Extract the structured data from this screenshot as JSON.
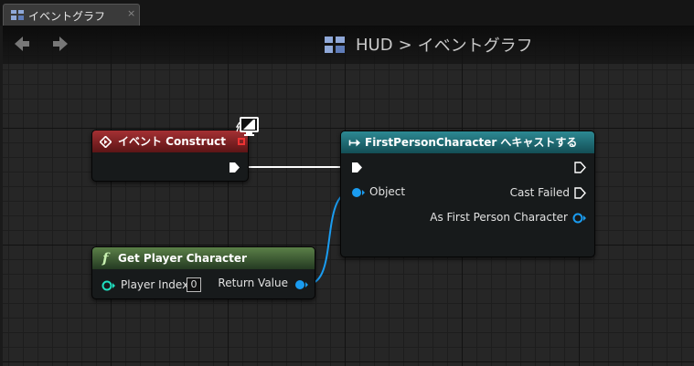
{
  "tab": {
    "title": "イベントグラフ",
    "close": "×",
    "icon": "blueprint-graph-icon"
  },
  "breadcrumb": {
    "icon": "blueprint-graph-icon",
    "parent": "HUD",
    "separator": ">",
    "current": "イベントグラフ"
  },
  "nav": {
    "back_icon": "arrow-left-icon",
    "forward_icon": "arrow-right-icon"
  },
  "nodes": {
    "event_construct": {
      "title": "イベント Construct",
      "icon": "event-diamond-icon"
    },
    "cast": {
      "title": "FirstPersonCharacter へキャストする",
      "icon": "cast-arrow-icon",
      "object_label": "Object",
      "cast_failed_label": "Cast Failed",
      "as_label": "As First Person Character"
    },
    "get_player": {
      "title": "Get Player Character",
      "icon": "function-f-icon",
      "player_index_label": "Player Index",
      "player_index_value": "0",
      "return_label": "Return Value"
    }
  },
  "colors": {
    "event_header": "#a43033",
    "cast_header": "#2d8993",
    "function_header": "#5b8048",
    "object_pin": "#1a9cf0",
    "int_pin": "#1fe0c0",
    "exec_pin": "#ffffff"
  }
}
